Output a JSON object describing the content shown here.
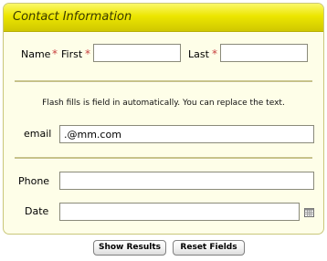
{
  "form": {
    "title": "Contact Information",
    "name_label": "Name",
    "first_label": "First",
    "last_label": "Last",
    "required_mark": "*",
    "note": "Flash fills is field in automatically. You can replace the text.",
    "email_label": "email",
    "email_value": ".@mm.com",
    "phone_label": "Phone",
    "date_label": "Date",
    "first_value": "",
    "last_value": "",
    "phone_value": "",
    "date_value": ""
  },
  "buttons": {
    "show_results": "Show Results",
    "reset_fields": "Reset Fields"
  },
  "icons": {
    "calendar": "calendar-icon"
  },
  "colors": {
    "header_yellow": "#ece600",
    "panel_bg": "#fefee8",
    "required_red": "#c84040",
    "separator": "#c7c28a"
  }
}
